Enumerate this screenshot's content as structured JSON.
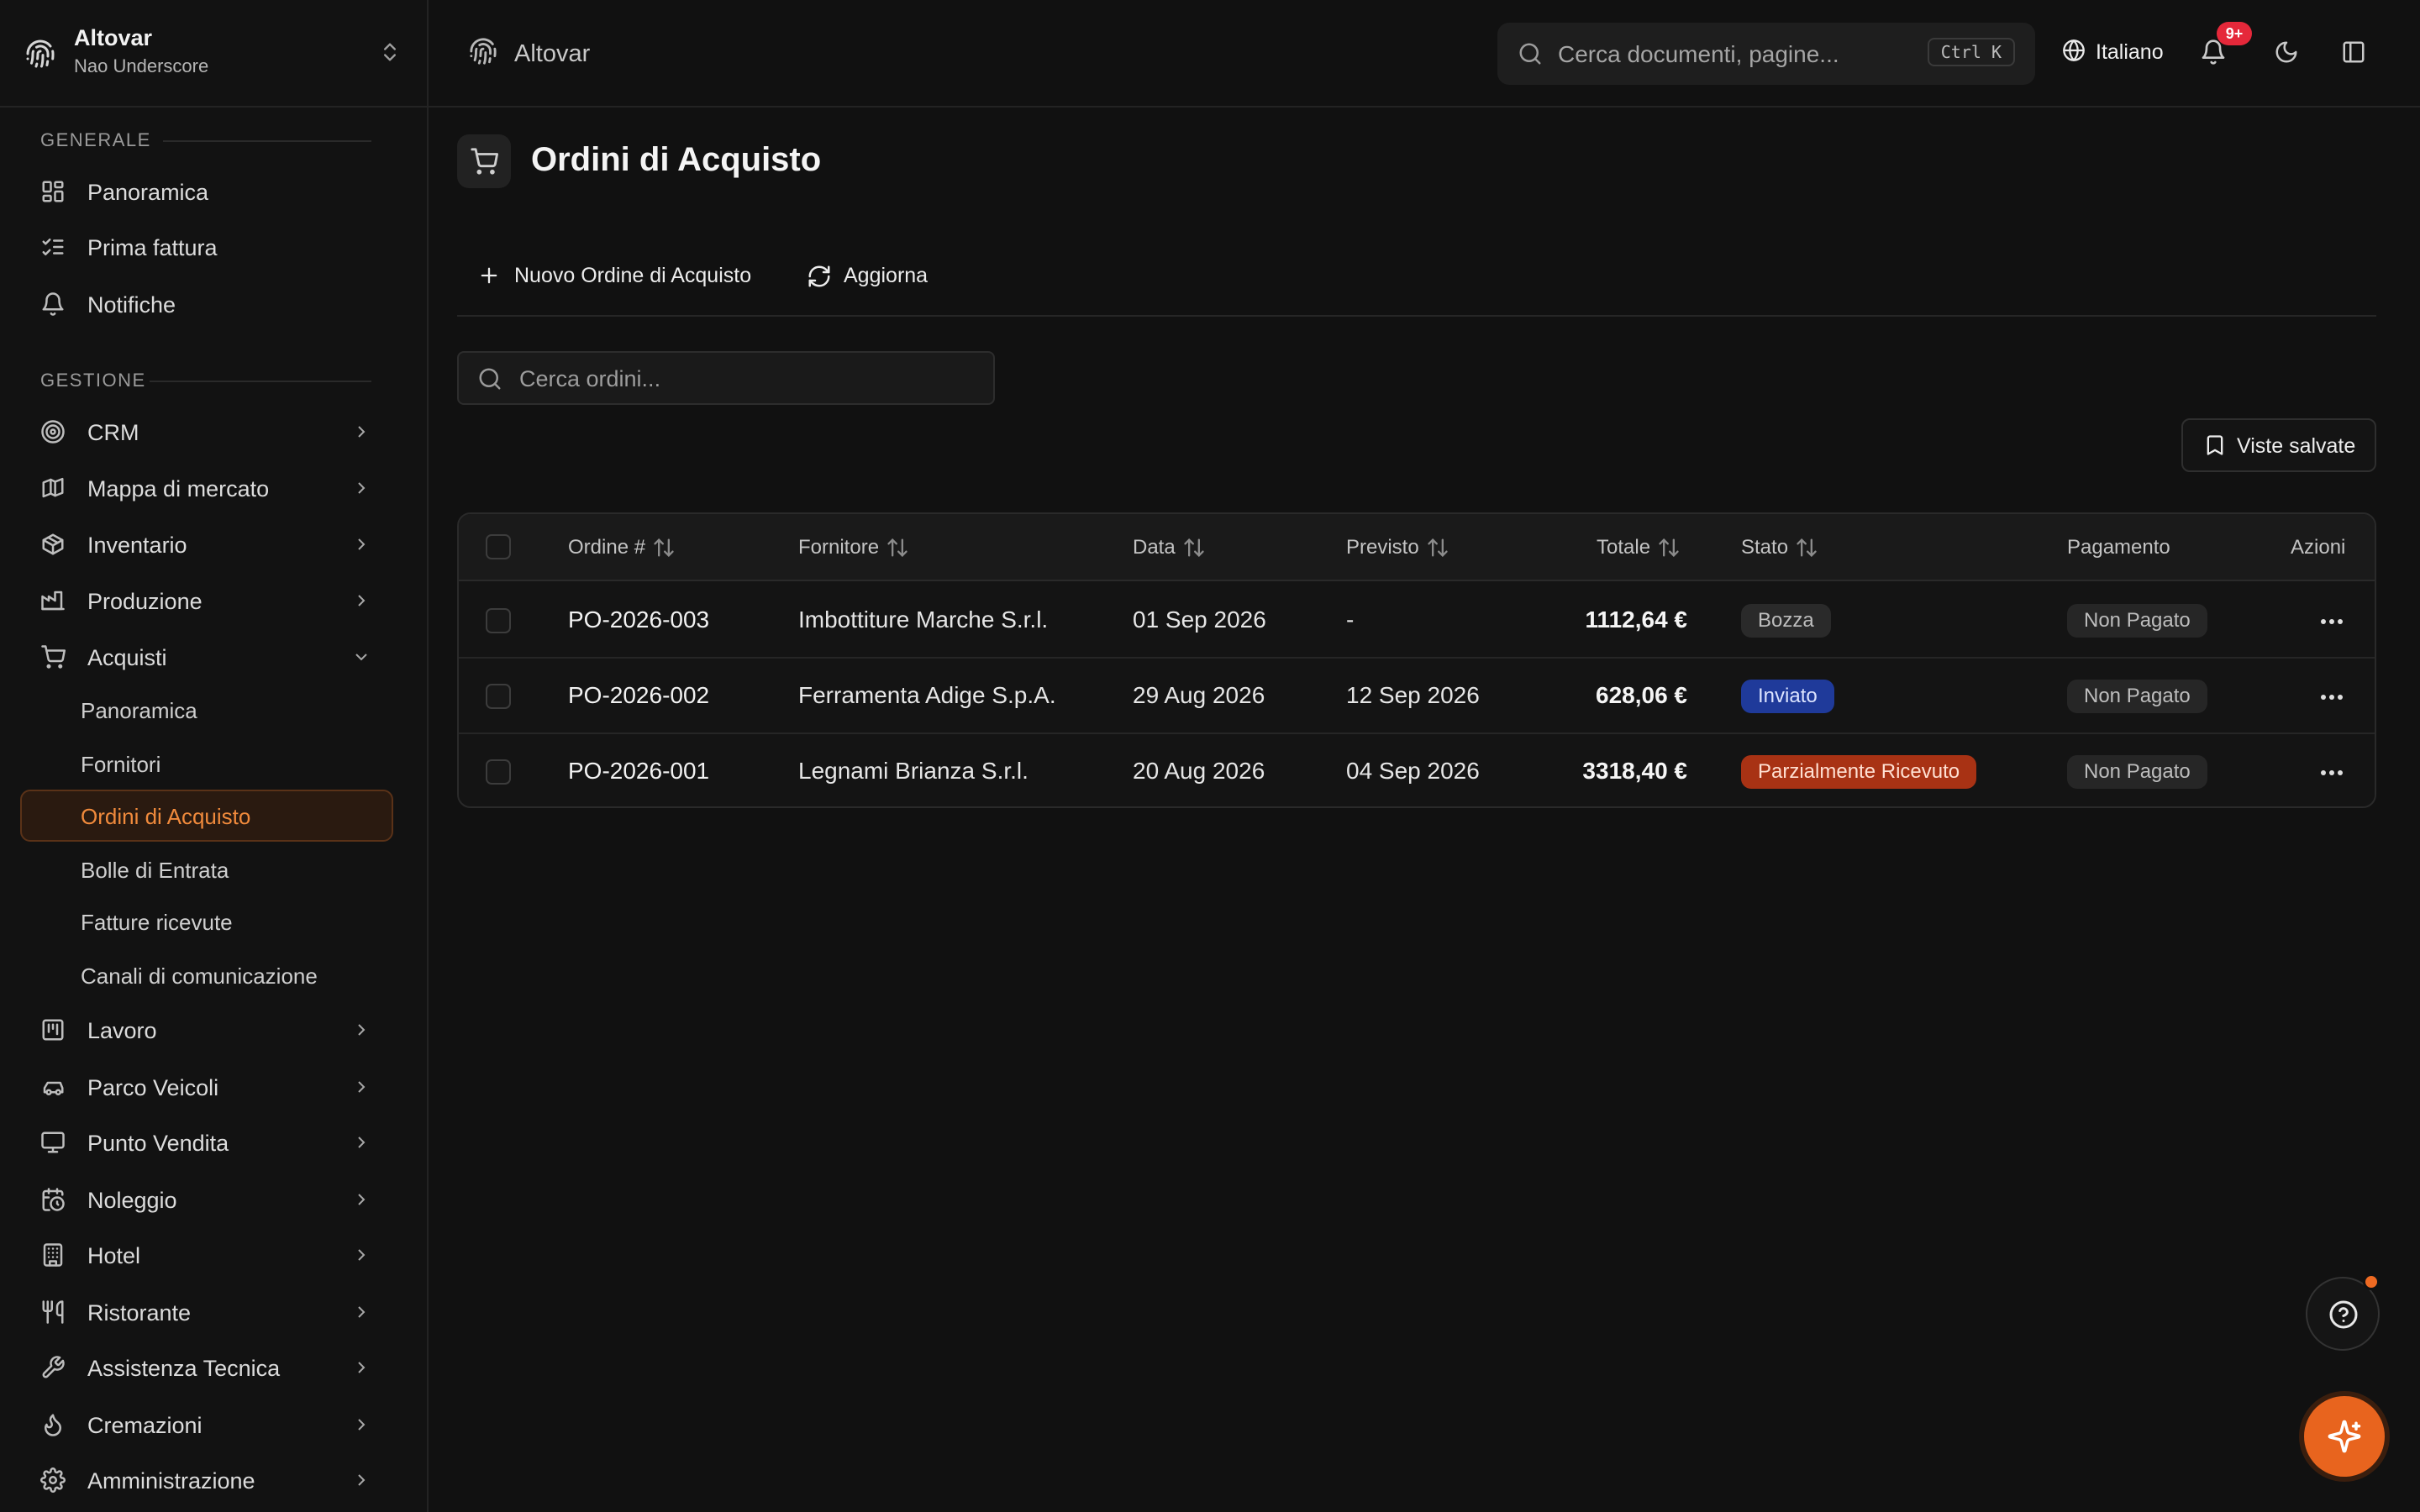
{
  "workspace": {
    "name": "Altovar",
    "user": "Nao Underscore"
  },
  "sidebar": {
    "sections": [
      {
        "label": "GENERALE"
      },
      {
        "label": "GESTIONE"
      }
    ],
    "general_items": [
      {
        "label": "Panoramica",
        "icon": "dashboard-icon"
      },
      {
        "label": "Prima fattura",
        "icon": "checklist-icon"
      },
      {
        "label": "Notifiche",
        "icon": "bell-icon"
      }
    ],
    "manage_items": [
      {
        "label": "CRM",
        "icon": "target-icon"
      },
      {
        "label": "Mappa di mercato",
        "icon": "map-icon"
      },
      {
        "label": "Inventario",
        "icon": "package-icon"
      },
      {
        "label": "Produzione",
        "icon": "factory-icon"
      },
      {
        "label": "Acquisti",
        "icon": "cart-icon",
        "expanded": true
      }
    ],
    "acquisti_sub": [
      {
        "label": "Panoramica"
      },
      {
        "label": "Fornitori"
      },
      {
        "label": "Ordini di Acquisto",
        "active": true
      },
      {
        "label": "Bolle di Entrata"
      },
      {
        "label": "Fatture ricevute"
      },
      {
        "label": "Canali di comunicazione"
      }
    ],
    "more_items": [
      {
        "label": "Lavoro",
        "icon": "kanban-icon"
      },
      {
        "label": "Parco Veicoli",
        "icon": "car-icon"
      },
      {
        "label": "Punto Vendita",
        "icon": "monitor-icon"
      },
      {
        "label": "Noleggio",
        "icon": "calendar-clock-icon"
      },
      {
        "label": "Hotel",
        "icon": "building-icon"
      },
      {
        "label": "Ristorante",
        "icon": "utensils-icon"
      },
      {
        "label": "Assistenza Tecnica",
        "icon": "wrench-icon"
      },
      {
        "label": "Cremazioni",
        "icon": "flame-icon"
      },
      {
        "label": "Amministrazione",
        "icon": "gear-icon"
      }
    ]
  },
  "header": {
    "breadcrumb": "Altovar",
    "search_placeholder": "Cerca documenti, pagine...",
    "search_shortcut": "Ctrl K",
    "language": "Italiano",
    "notifications_badge": "9+"
  },
  "main": {
    "title": "Ordini di Acquisto",
    "new_button": "Nuovo Ordine di Acquisto",
    "refresh_button": "Aggiorna",
    "search_placeholder": "Cerca ordini...",
    "saved_views_button": "Viste salvate",
    "columns": {
      "order": "Ordine #",
      "supplier": "Fornitore",
      "date": "Data",
      "expected": "Previsto",
      "total": "Totale",
      "status": "Stato",
      "payment": "Pagamento",
      "actions": "Azioni"
    },
    "rows": [
      {
        "order": "PO-2026-003",
        "supplier": "Imbottiture Marche S.r.l.",
        "date": "01 Sep 2026",
        "expected": "-",
        "total": "1112,64 €",
        "status": "Bozza",
        "status_kind": "draft",
        "payment": "Non Pagato"
      },
      {
        "order": "PO-2026-002",
        "supplier": "Ferramenta Adige S.p.A.",
        "date": "29 Aug 2026",
        "expected": "12 Sep 2026",
        "total": "628,06 €",
        "status": "Inviato",
        "status_kind": "sent",
        "payment": "Non Pagato"
      },
      {
        "order": "PO-2026-001",
        "supplier": "Legnami Brianza S.r.l.",
        "date": "20 Aug 2026",
        "expected": "04 Sep 2026",
        "total": "3318,40 €",
        "status": "Parzialmente Ricevuto",
        "status_kind": "partial",
        "payment": "Non Pagato"
      }
    ]
  },
  "colors": {
    "accent": "#e8641e",
    "badge_sent": "#1f3a9a",
    "badge_partial": "#a83214",
    "notification": "#e5283a"
  }
}
